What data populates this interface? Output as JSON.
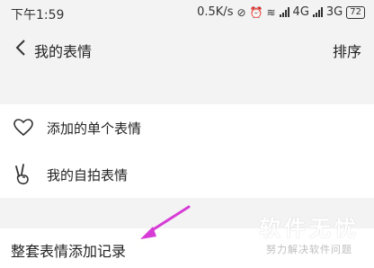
{
  "status_bar": {
    "time": "下午1:59",
    "speed": "0.5K/s",
    "network1": "4G",
    "network2": "3G",
    "battery": "72"
  },
  "nav": {
    "title": "我的表情",
    "action": "排序",
    "back_icon": "chevron-left-icon"
  },
  "list": {
    "items": [
      {
        "label": "添加的单个表情",
        "icon": "heart-outline-icon"
      },
      {
        "label": "我的自拍表情",
        "icon": "peace-hand-icon"
      }
    ]
  },
  "section": {
    "label": "整套表情添加记录"
  },
  "annotation": {
    "arrow_color": "#d63bd6"
  },
  "watermark": {
    "main": "软件无忧",
    "sub": "努力解决软件问题"
  }
}
